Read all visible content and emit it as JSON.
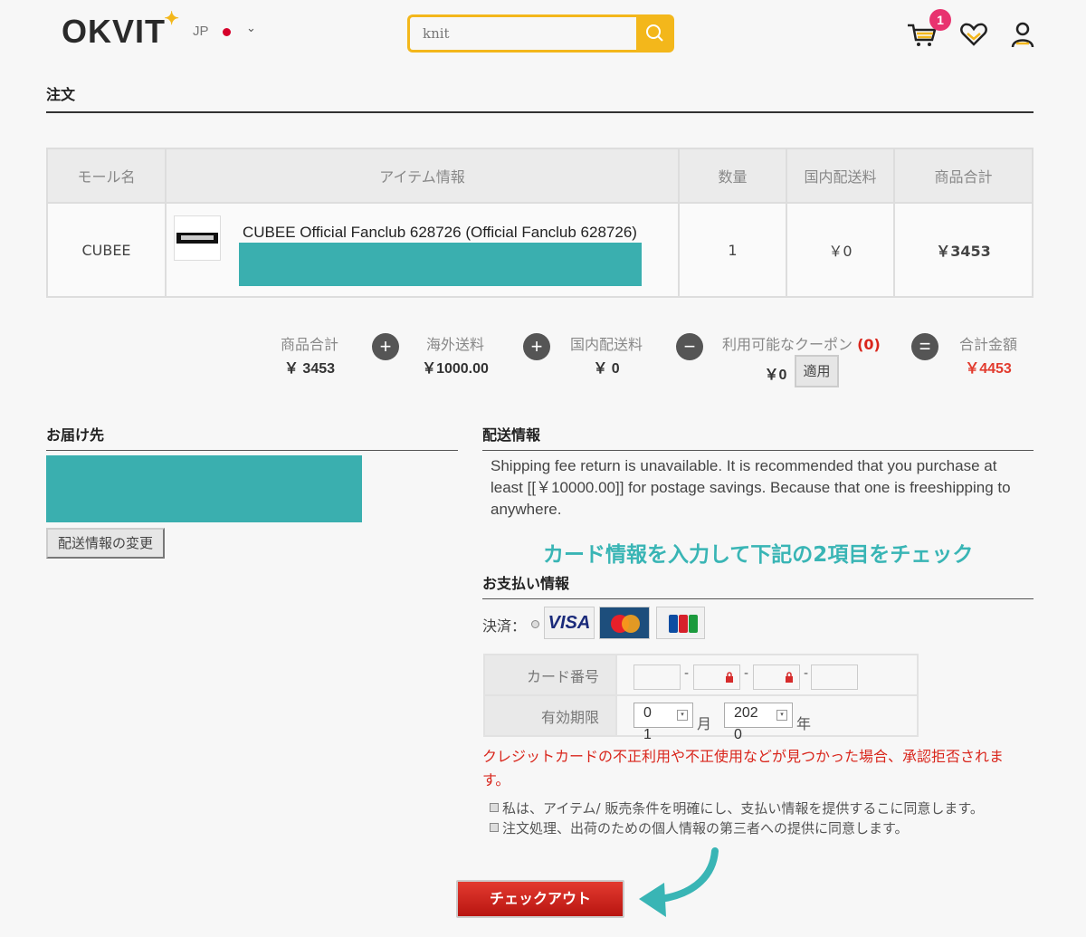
{
  "header": {
    "logo": "OKVIT",
    "logo_star": "✦",
    "region": "JP",
    "search_value": "knit",
    "cart_count": "1"
  },
  "order": {
    "title": "注文",
    "columns": [
      "モール名",
      "アイテム情報",
      "数量",
      "国内配送料",
      "商品合計"
    ],
    "row": {
      "mall": "CUBEE",
      "item_name": "CUBEE Official Fanclub 628726  (Official Fanclub 628726)",
      "quantity": "1",
      "domestic_shipping": "￥0",
      "subtotal": "￥3453"
    }
  },
  "totals": {
    "product_total_label": "商品合計",
    "product_total": "￥ 3453",
    "overseas_label": "海外送料",
    "overseas": "￥1000.00",
    "domestic_label": "国内配送料",
    "domestic": "￥ 0",
    "coupon_label": "利用可能なクーポン",
    "coupon_count": "(0)",
    "coupon_value": "￥0",
    "apply_label": "適用",
    "grand_label": "合計金額",
    "grand_total": "￥4453",
    "ops": [
      "+",
      "+",
      "−",
      "="
    ]
  },
  "delivery": {
    "title": "お届け先",
    "change_button": "配送情報の変更"
  },
  "shipping_info": {
    "title": "配送情報",
    "text": "Shipping fee return is unavailable. It is recommended that you purchase at least [[￥10000.00]] for postage savings. Because that one is freeshipping to anywhere."
  },
  "annotation": "カード情報を入力して下記の2項目をチェック",
  "payment": {
    "title": "お支払い情報",
    "method_label": "決済：",
    "card_brands": [
      "VISA",
      "MasterCard",
      "JCB"
    ],
    "card_number_label": "カード番号",
    "expiry_label": "有効期限",
    "month_value": "0",
    "month_wrap": "1",
    "month_unit": "月",
    "year_value": "202",
    "year_wrap": "0",
    "year_unit": "年",
    "warning": "クレジットカードの不正利用や不正使用などが見つかった場合、承認拒否されます。",
    "agree_1": "私は、アイテム/ 販売条件を明確にし、支払い情報を提供するこに同意します。",
    "agree_2": "注文処理、出荷のための個人情報の第三者への提供に同意します。"
  },
  "checkout_label": "チェックアウト",
  "colors": {
    "accent": "#f3b71b",
    "badge": "#e8336f",
    "teal": "#39b5b5",
    "red": "#d9261c"
  }
}
